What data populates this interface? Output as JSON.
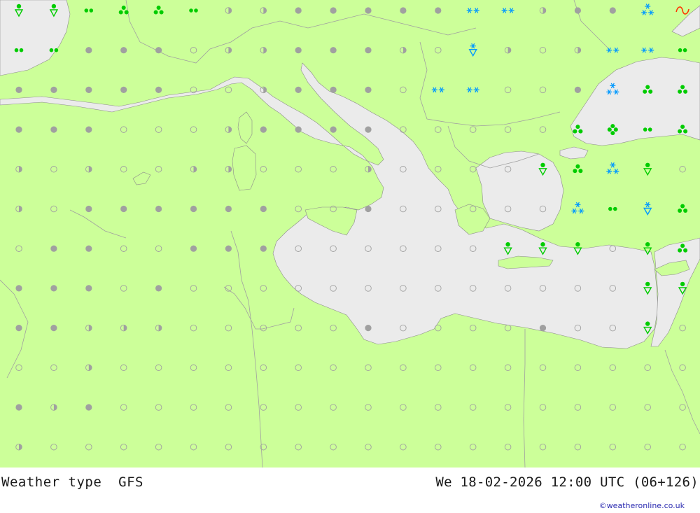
{
  "map": {
    "title": "Weather type  GFS",
    "valid_time": "We 18-02-2026 12:00 UTC (06+126)",
    "credit": "©weatheronline.co.uk",
    "colors": {
      "land": "#ccff99",
      "sea": "#ebebeb",
      "border": "#a0a0a0",
      "dry_cloudy": "#a0a0a0",
      "rain": "#00cc00",
      "snow": "#0099ff",
      "freezing": "#ff3300"
    },
    "symbols": [
      [
        "rain-shower",
        "rain-shower",
        "drizzle",
        "rain-showers",
        "rain-showers",
        "drizzle",
        "half-cloudy",
        "half-cloudy",
        "cloudy",
        "cloudy",
        "cloudy",
        "cloudy",
        "cloudy",
        "snow",
        "snow",
        "half-cloudy",
        "cloudy",
        "cloudy",
        "snow-heavy",
        "mixed-freezing"
      ],
      [
        "drizzle",
        "drizzle",
        "cloudy",
        "cloudy",
        "cloudy",
        "clear",
        "half-cloudy",
        "half-cloudy",
        "cloudy",
        "cloudy",
        "cloudy",
        "half-cloudy",
        "clear",
        "snow-shower",
        "half-cloudy",
        "clear",
        "half-cloudy",
        "snow",
        "snow",
        "drizzle"
      ],
      [
        "cloudy",
        "cloudy",
        "cloudy",
        "cloudy",
        "cloudy",
        "clear",
        "clear",
        "half-cloudy",
        "cloudy",
        "cloudy",
        "cloudy",
        "clear",
        "snow",
        "snow",
        "clear",
        "clear",
        "cloudy",
        "snow-heavy",
        "rain-showers",
        "rain-showers"
      ],
      [
        "cloudy",
        "cloudy",
        "cloudy",
        "clear",
        "clear",
        "clear",
        "half-cloudy",
        "cloudy",
        "cloudy",
        "cloudy",
        "cloudy",
        "clear",
        "clear",
        "clear",
        "clear",
        "clear",
        "rain-showers",
        "rain-heavy",
        "drizzle",
        "rain-showers"
      ],
      [
        "half-cloudy",
        "clear",
        "half-cloudy",
        "clear",
        "clear",
        "half-cloudy",
        "half-cloudy",
        "clear",
        "clear",
        "clear",
        "half-cloudy",
        "clear",
        "clear",
        "clear",
        "clear",
        "rain-shower",
        "rain-showers",
        "snow-heavy",
        "rain-shower",
        "clear"
      ],
      [
        "half-cloudy",
        "clear",
        "cloudy",
        "cloudy",
        "cloudy",
        "cloudy",
        "cloudy",
        "cloudy",
        "clear",
        "clear",
        "cloudy",
        "clear",
        "clear",
        "clear",
        "clear",
        "clear",
        "snow-heavy",
        "drizzle",
        "snow-shower",
        "rain-showers"
      ],
      [
        "clear",
        "cloudy",
        "cloudy",
        "clear",
        "clear",
        "cloudy",
        "cloudy",
        "cloudy",
        "clear",
        "clear",
        "clear",
        "clear",
        "clear",
        "clear",
        "rain-shower",
        "rain-shower",
        "rain-shower",
        "clear",
        "rain-shower",
        "rain-showers"
      ],
      [
        "cloudy",
        "cloudy",
        "cloudy",
        "clear",
        "cloudy",
        "clear",
        "clear",
        "clear",
        "clear",
        "clear",
        "clear",
        "clear",
        "clear",
        "clear",
        "clear",
        "clear",
        "clear",
        "clear",
        "rain-shower",
        "rain-shower"
      ],
      [
        "cloudy",
        "cloudy",
        "half-cloudy",
        "half-cloudy",
        "half-cloudy",
        "clear",
        "clear",
        "clear",
        "clear",
        "clear",
        "cloudy",
        "clear",
        "clear",
        "clear",
        "clear",
        "cloudy",
        "clear",
        "clear",
        "rain-shower",
        "clear"
      ],
      [
        "clear",
        "clear",
        "half-cloudy",
        "clear",
        "clear",
        "clear",
        "clear",
        "clear",
        "clear",
        "clear",
        "clear",
        "clear",
        "clear",
        "clear",
        "clear",
        "clear",
        "clear",
        "clear",
        "clear",
        "clear"
      ],
      [
        "cloudy",
        "half-cloudy",
        "cloudy",
        "clear",
        "clear",
        "clear",
        "clear",
        "clear",
        "clear",
        "clear",
        "clear",
        "clear",
        "clear",
        "clear",
        "clear",
        "clear",
        "clear",
        "clear",
        "clear",
        "clear"
      ],
      [
        "half-cloudy",
        "clear",
        "clear",
        "clear",
        "clear",
        "clear",
        "clear",
        "clear",
        "clear",
        "clear",
        "clear",
        "clear",
        "clear",
        "clear",
        "clear",
        "clear",
        "clear",
        "clear",
        "clear",
        "clear"
      ]
    ]
  }
}
